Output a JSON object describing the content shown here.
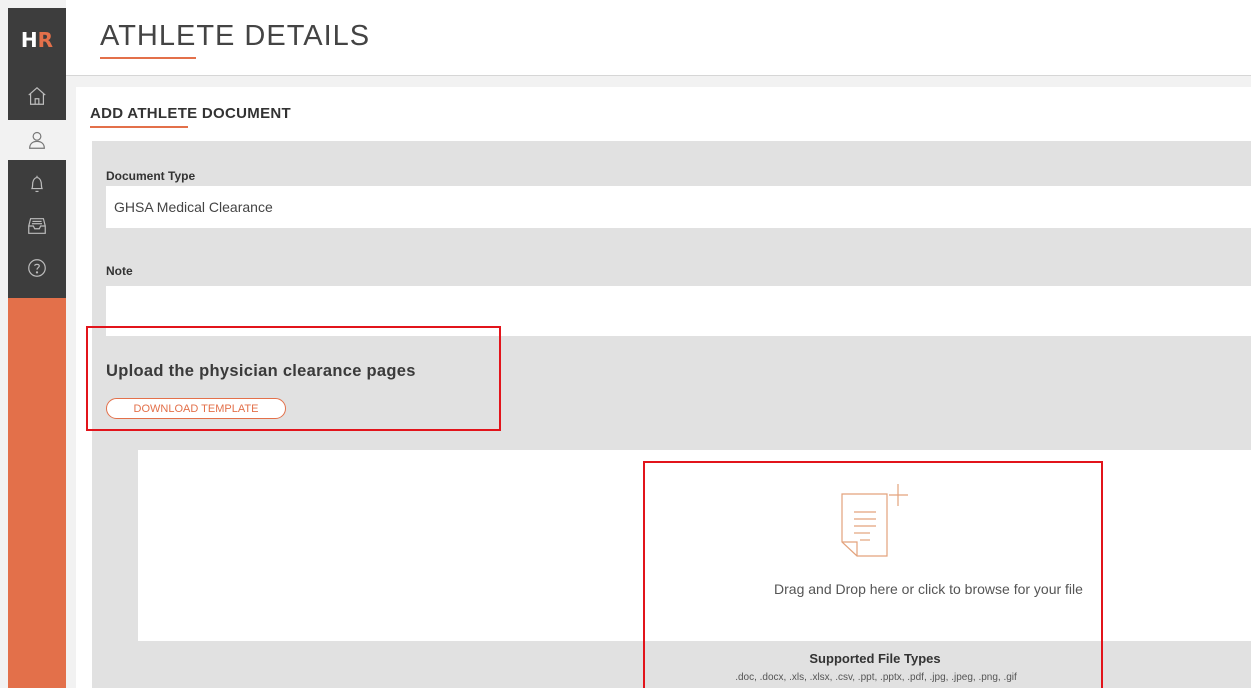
{
  "app": {
    "logo_text_left": "H",
    "logo_text_right": "R",
    "brand_color": "#e3704a"
  },
  "sidebar": {
    "items": [
      {
        "name": "home",
        "icon": "home-icon",
        "active": false
      },
      {
        "name": "athletes",
        "icon": "user-icon",
        "active": true
      },
      {
        "name": "notifications",
        "icon": "bell-icon",
        "active": false
      },
      {
        "name": "inbox",
        "icon": "inbox-icon",
        "active": false
      },
      {
        "name": "help",
        "icon": "help-icon",
        "active": false
      }
    ]
  },
  "header": {
    "title": "ATHLETE DETAILS"
  },
  "card": {
    "title": "ADD ATHLETE DOCUMENT"
  },
  "form": {
    "document_type_label": "Document Type",
    "document_type_value": "GHSA Medical Clearance",
    "note_label": "Note",
    "note_value": "",
    "upload_heading": "Upload the physician clearance pages",
    "download_template_label": "DOWNLOAD TEMPLATE"
  },
  "dropzone": {
    "icon": "document-add-icon",
    "text": "Drag and Drop here or click to browse for your file",
    "supported_title": "Supported File Types",
    "supported_types": ".doc, .docx, .xls, .xlsx, .csv, .ppt, .pptx, .pdf, .jpg, .jpeg, .png, .gif"
  },
  "highlight_color": "#e2141b"
}
